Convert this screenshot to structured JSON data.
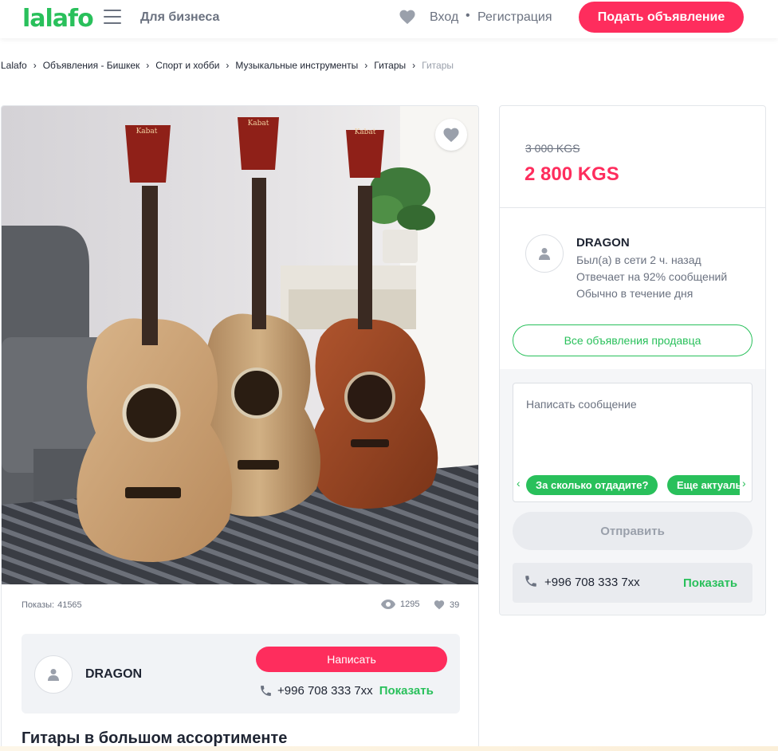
{
  "header": {
    "logo": "lalafo",
    "for_business": "Для бизнеса",
    "login": "Вход",
    "separator": "•",
    "register": "Регистрация",
    "post_ad": "Подать объявление"
  },
  "breadcrumb": [
    {
      "label": "Lalafo"
    },
    {
      "label": "Объявления - Бишкек"
    },
    {
      "label": "Спорт и хобби"
    },
    {
      "label": "Музыкальные инструменты"
    },
    {
      "label": "Гитары"
    },
    {
      "label": "Гитары"
    }
  ],
  "ad": {
    "photo_brand": "Kabat",
    "views_label": "Показы:",
    "views_value": "41565",
    "eye_count": "1295",
    "like_count": "39",
    "title": "Гитары в большом ассортименте"
  },
  "seller": {
    "name": "DRAGON",
    "status": "Был(а) в сети 2 ч. назад",
    "reply_rate": "Отвечает на 92% сообщений",
    "reply_time": "Обычно в течение дня",
    "all_ads": "Все объявления продавца",
    "phone": "+996 708 333 7xx",
    "show": "Показать",
    "write": "Написать"
  },
  "price": {
    "old": "3 000 KGS",
    "current": "2 800 KGS"
  },
  "message": {
    "placeholder": "Написать сообщение",
    "chips": [
      "За сколько отдадите?",
      "Еще актуально?"
    ],
    "prev": "‹",
    "next": "›",
    "send": "Отправить"
  },
  "colors": {
    "brand_green": "#29c05b",
    "accent_pink": "#fe2d5d",
    "text_gray": "#6b7280"
  },
  "icons": [
    "burger-menu-icon",
    "heart-icon",
    "user-icon",
    "phone-icon",
    "eye-icon",
    "chevron-right-icon"
  ]
}
